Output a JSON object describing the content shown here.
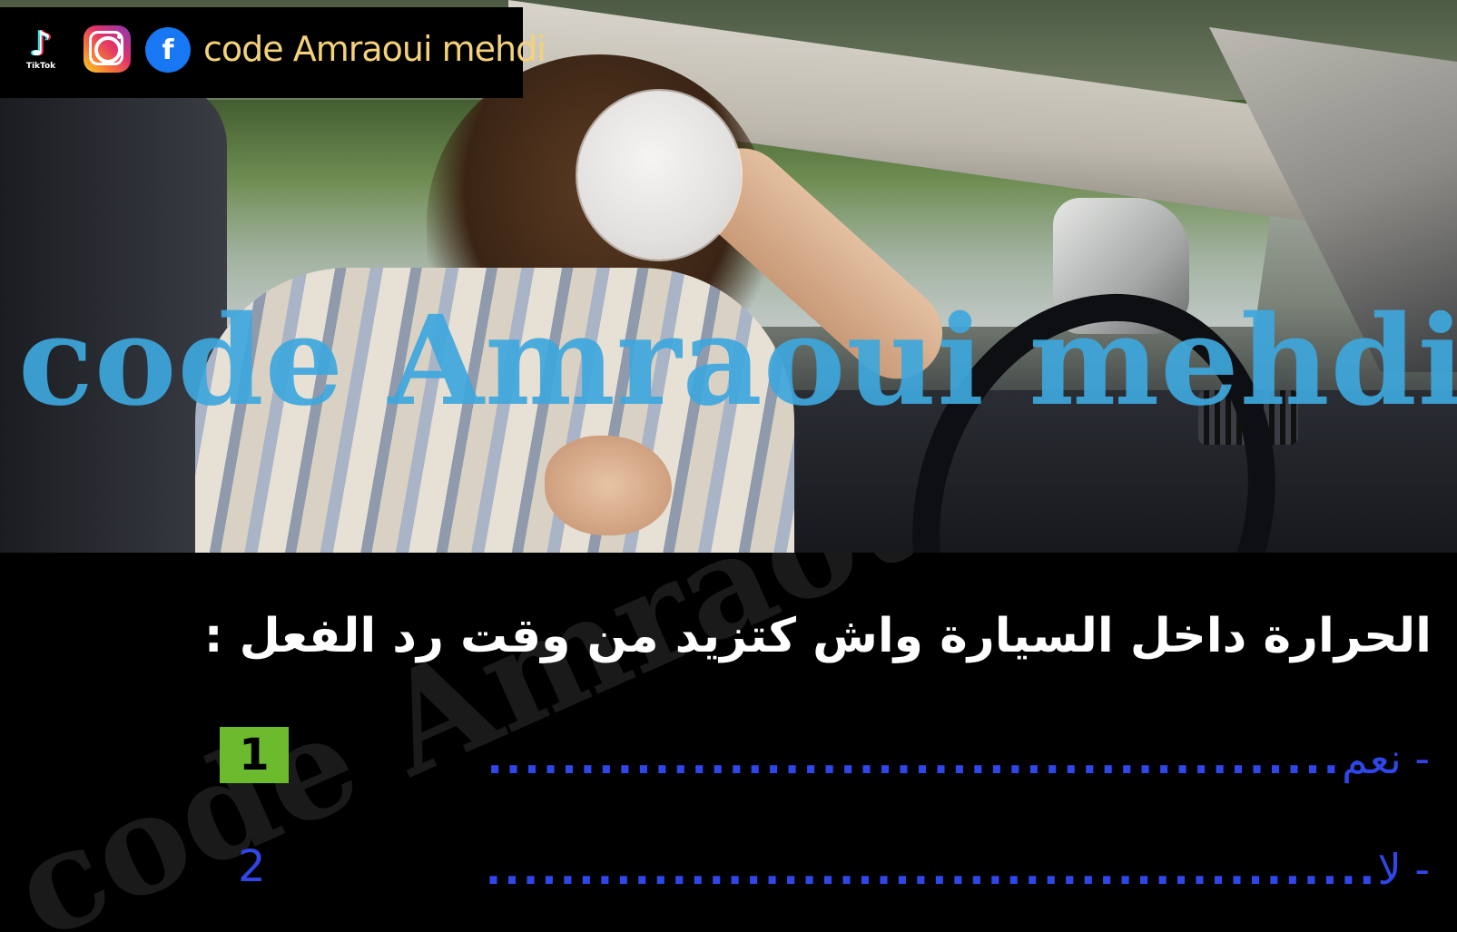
{
  "brand": {
    "tiktok_label": "TikTok",
    "facebook_letter": "f",
    "channel_name": "code Amraoui mehdi"
  },
  "watermark": {
    "text": "code Amraoui mehdi"
  },
  "question": {
    "text": "الحرارة داخل السيارة واش كتزيد من وقت رد الفعل :"
  },
  "answers": [
    {
      "label": "- نعم",
      "number": "1",
      "selected": true
    },
    {
      "label": "- لا",
      "number": "2",
      "selected": false
    }
  ],
  "colors": {
    "answer_text": "#2f46e8",
    "badge": "#6cbb2e",
    "watermark": "#3ea7dd",
    "brand_text": "#f3d27a"
  }
}
